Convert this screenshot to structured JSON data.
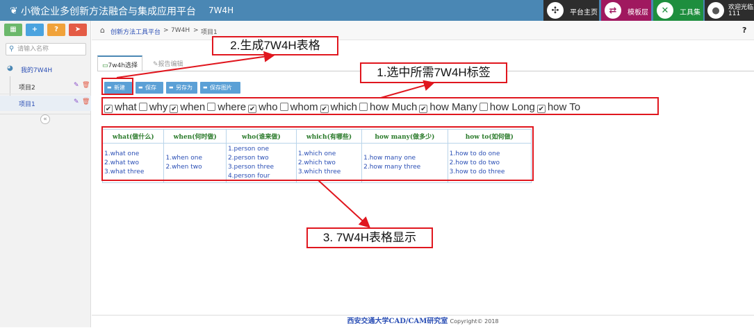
{
  "header": {
    "title": "小微企业多创新方法融合与集成应用平台",
    "subtitle": "7W4H",
    "buttons": [
      {
        "label": "平台主页",
        "icon": "network-icon",
        "color": "#2d2d2d"
      },
      {
        "label": "模板层",
        "icon": "shuffle-icon",
        "color": "#a0185f"
      },
      {
        "label": "工具集",
        "icon": "tools-icon",
        "color": "#1e8e3e"
      }
    ],
    "user_greeting": "欢迎光临,",
    "user_name": "111",
    "help": "?"
  },
  "sidebar": {
    "search_placeholder": "请输入名称",
    "root": "我的7W4H",
    "items": [
      "项目2",
      "项目1"
    ],
    "collapse": "«"
  },
  "breadcrumb": {
    "items": [
      "创新方法工具平台",
      "7W4H",
      "项目1"
    ],
    "sep": ">"
  },
  "tabs": [
    "7w4h选择",
    "报告编辑"
  ],
  "toolbar": [
    "新建",
    "保存",
    "另存为",
    "保存图片"
  ],
  "options": [
    {
      "label": "what",
      "checked": true
    },
    {
      "label": "why",
      "checked": false
    },
    {
      "label": "when",
      "checked": true
    },
    {
      "label": "where",
      "checked": false
    },
    {
      "label": "who",
      "checked": true
    },
    {
      "label": "whom",
      "checked": false
    },
    {
      "label": "which",
      "checked": true
    },
    {
      "label": "how Much",
      "checked": false
    },
    {
      "label": "how Many",
      "checked": true
    },
    {
      "label": "how Long",
      "checked": false
    },
    {
      "label": "how To",
      "checked": true
    }
  ],
  "table": {
    "headers": [
      "what(做什么)",
      "when(何时做)",
      "who(谁来做)",
      "which(有哪些)",
      "how many(做多少)",
      "how to(如何做)"
    ],
    "cells": [
      [
        "1.what one",
        "2.what two",
        "3.what three"
      ],
      [
        "1.when one",
        "2.when two"
      ],
      [
        "1.person one",
        "2.person two",
        "3.person three",
        "4.person four"
      ],
      [
        "1.which one",
        "2.which two",
        "3.which three"
      ],
      [
        "1.how many one",
        "2.how many three"
      ],
      [
        "1.how to do one",
        "2.how to do two",
        "3.how to do three"
      ]
    ]
  },
  "annotations": {
    "a1": "1.选中所需7W4H标签",
    "a2": "2.生成7W4H表格",
    "a3": "3. 7W4H表格显示"
  },
  "footer": {
    "org": "西安交通大学CAD/CAM研究室",
    "copyright": "Copyright© 2018"
  },
  "colors": {
    "accent": "#4a87b4",
    "annotation": "#e0161e",
    "button": "#5ba0d6"
  }
}
